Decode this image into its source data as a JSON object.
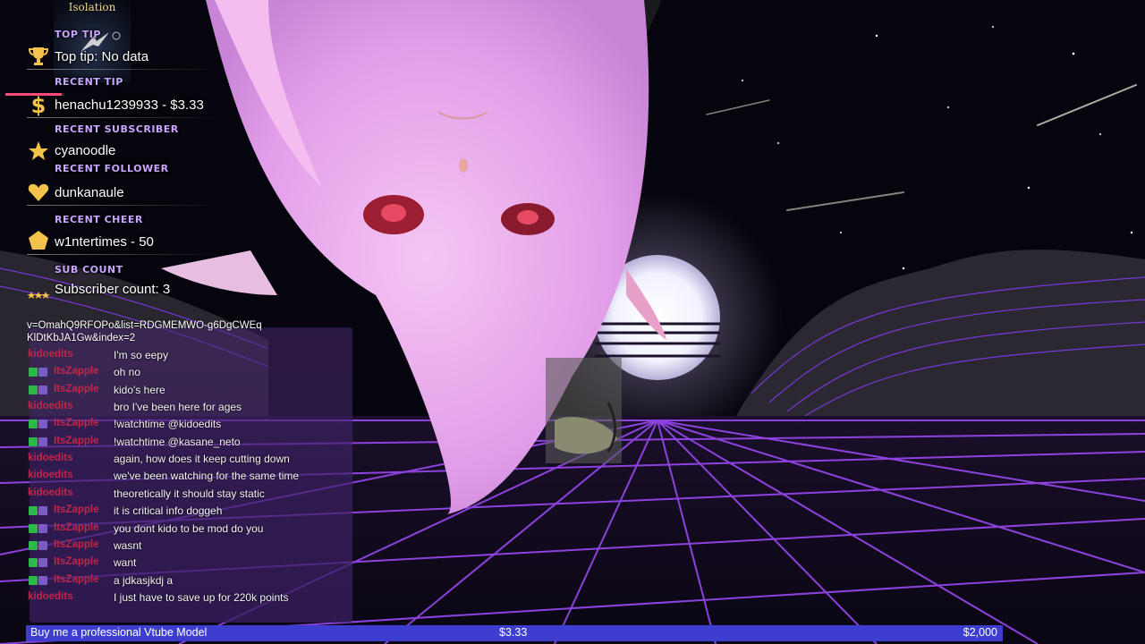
{
  "album": {
    "title": "Isolation"
  },
  "now_playing": {
    "progress": 0.95
  },
  "widgets": [
    {
      "category": "TOP TIP",
      "value": "Top tip: No data",
      "icon": "trophy-icon"
    },
    {
      "category": "RECENT TIP",
      "value": "henachu1239933 - $3.33",
      "icon": "dollar-icon"
    },
    {
      "category": "RECENT SUBSCRIBER",
      "value": "cyanoodle",
      "icon": "star-icon"
    },
    {
      "category": "RECENT FOLLOWER",
      "value": "dunkanaule",
      "icon": "heart-icon"
    },
    {
      "category": "RECENT CHEER",
      "value": "w1ntertimes - 50",
      "icon": "gem-icon"
    },
    {
      "category": "SUB COUNT",
      "value": "Subscriber count: 3",
      "icon": "stars-icon"
    }
  ],
  "chat": {
    "url_text": "v=OmahQ9RFOPo&list=RDGMEMWO-g6DgCWEqKlDtKbJA1Gw&index=2",
    "messages": [
      {
        "user": "kidoedits",
        "text": "I'm so eepy",
        "badges": false
      },
      {
        "user": "ItsZapple",
        "text": "oh no",
        "badges": true
      },
      {
        "user": "ItsZapple",
        "text": "kido's here",
        "badges": true
      },
      {
        "user": "kidoedits",
        "text": "bro I've been here for ages",
        "badges": false
      },
      {
        "user": "ItsZapple",
        "text": "!watchtime @kidoedits",
        "badges": true
      },
      {
        "user": "ItsZapple",
        "text": "!watchtime @kasane_neto",
        "badges": true
      },
      {
        "user": "kidoedits",
        "text": "again, how does it keep cutting down",
        "badges": false
      },
      {
        "user": "kidoedits",
        "text": "we've been watching for the same time",
        "badges": false
      },
      {
        "user": "kidoedits",
        "text": "theoretically it should stay static",
        "badges": false
      },
      {
        "user": "ItsZapple",
        "text": "it is critical info doggeh",
        "badges": true
      },
      {
        "user": "ItsZapple",
        "text": "you dont kido to be mod do you",
        "badges": true
      },
      {
        "user": "ItsZapple",
        "text": "wasnt",
        "badges": true
      },
      {
        "user": "ItsZapple",
        "text": "want",
        "badges": true
      },
      {
        "user": "ItsZapple",
        "text": "a jdkasjkdj a",
        "badges": true
      },
      {
        "user": "kidoedits",
        "text": "I just have to save up for 220k points",
        "badges": false
      }
    ]
  },
  "goal": {
    "label": "Buy me a professional Vtube Model",
    "current": "$3.33",
    "target": "$2,000",
    "fraction": 0.0017
  },
  "colors": {
    "accent": "#c9a6ff",
    "chat_username": "#c1264a",
    "goal_bar": "#3d3ecf",
    "grid": "#a24cff"
  }
}
